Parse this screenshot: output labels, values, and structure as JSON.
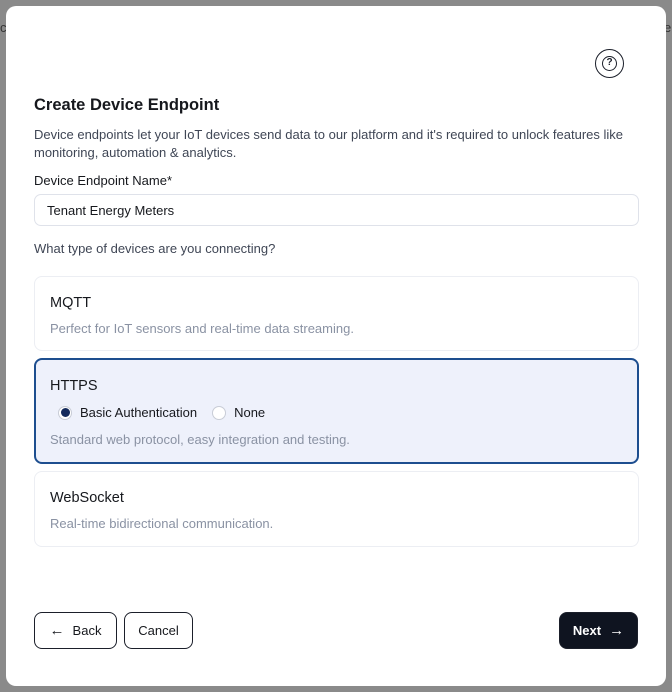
{
  "backdrop": {
    "fragment_left": "c",
    "fragment_right": "e"
  },
  "modal": {
    "title": "Create Device Endpoint",
    "description": "Device endpoints let your IoT devices send data to our platform and it's required to unlock features like monitoring, automation & analytics.",
    "help_icon_glyph": "?"
  },
  "name_field": {
    "label": "Device Endpoint Name*",
    "value": "Tenant Energy Meters"
  },
  "device_type": {
    "question": "What type of devices are you connecting?",
    "options": [
      {
        "title": "MQTT",
        "description": "Perfect for IoT sensors and real-time data streaming.",
        "selected": false
      },
      {
        "title": "HTTPS",
        "description": "Standard web protocol, easy integration and testing.",
        "selected": true,
        "auth": [
          {
            "label": "Basic Authentication",
            "checked": true
          },
          {
            "label": "None",
            "checked": false
          }
        ]
      },
      {
        "title": "WebSocket",
        "description": "Real-time bidirectional communication.",
        "selected": false
      }
    ]
  },
  "footer": {
    "back_label": "Back",
    "cancel_label": "Cancel",
    "next_label": "Next",
    "back_icon": "arrow-left-icon",
    "next_icon": "arrow-right-icon"
  },
  "colors": {
    "accent": "#1d4e8f",
    "selected_bg": "#eef1fb",
    "primary_button": "#0f1420"
  }
}
